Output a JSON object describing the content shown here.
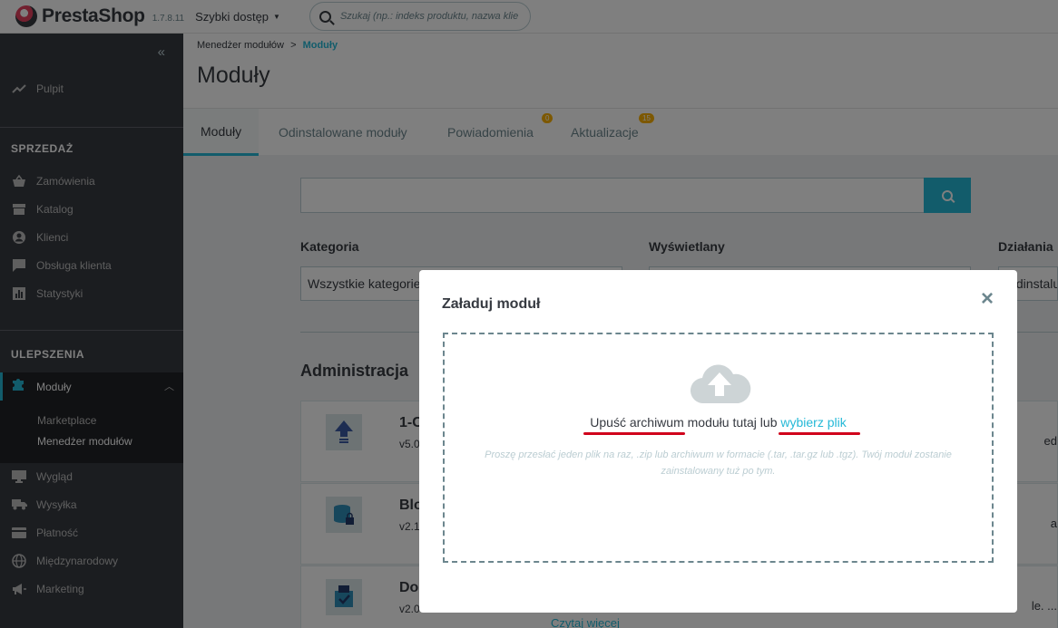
{
  "header": {
    "brand": "PrestaShop",
    "version": "1.7.8.11",
    "quick_access": "Szybki dostęp",
    "search_placeholder": "Szukaj (np.: indeks produktu, nazwa klienta…)"
  },
  "sidebar": {
    "dashboard": "Pulpit",
    "section_sell": "SPRZEDAŻ",
    "sell_items": [
      "Zamówienia",
      "Katalog",
      "Klienci",
      "Obsługa klienta",
      "Statystyki"
    ],
    "section_improve": "ULEPSZENIA",
    "active_item": "Moduły",
    "active_sub": [
      "Marketplace",
      "Menedżer modułów"
    ],
    "improve_items": [
      "Wygląd",
      "Wysyłka",
      "Płatność",
      "Międzynarodowy",
      "Marketing"
    ]
  },
  "page": {
    "breadcrumb_parent": "Menedżer modułów",
    "breadcrumb_sep": ">",
    "breadcrumb_current": "Moduły",
    "title": "Moduły"
  },
  "tabs": [
    {
      "label": "Moduły"
    },
    {
      "label": "Odinstalowane moduły"
    },
    {
      "label": "Powiadomienia",
      "badge": "0"
    },
    {
      "label": "Aktualizacje",
      "badge": "15"
    }
  ],
  "filters": {
    "category_label": "Kategoria",
    "category_value": "Wszystkie kategorie",
    "display_label": "Wyświetlany",
    "actions_label": "Działania",
    "actions_value": "Odinstalu"
  },
  "section_title": "Administracja",
  "modules": [
    {
      "name": "1-C",
      "version": "v5.0",
      "right": "ed"
    },
    {
      "name": "Blo",
      "version": "v2.1",
      "right": "a"
    },
    {
      "name": "Do",
      "version": "v2.0",
      "right": "le. ..."
    }
  ],
  "read_more": "Czytaj więcej",
  "modal": {
    "title": "Załaduj moduł",
    "close": "×",
    "drop_part1": "Upuść archiwum",
    "drop_part2": " modułu tutaj lub ",
    "drop_link": "wybierz plik",
    "hint": "Proszę przesłać jeden plik na raz, .zip lub archiwum w formacie (.tar, .tar.gz lub .tgz). Twój moduł zostanie zainstalowany tuż po tym."
  }
}
